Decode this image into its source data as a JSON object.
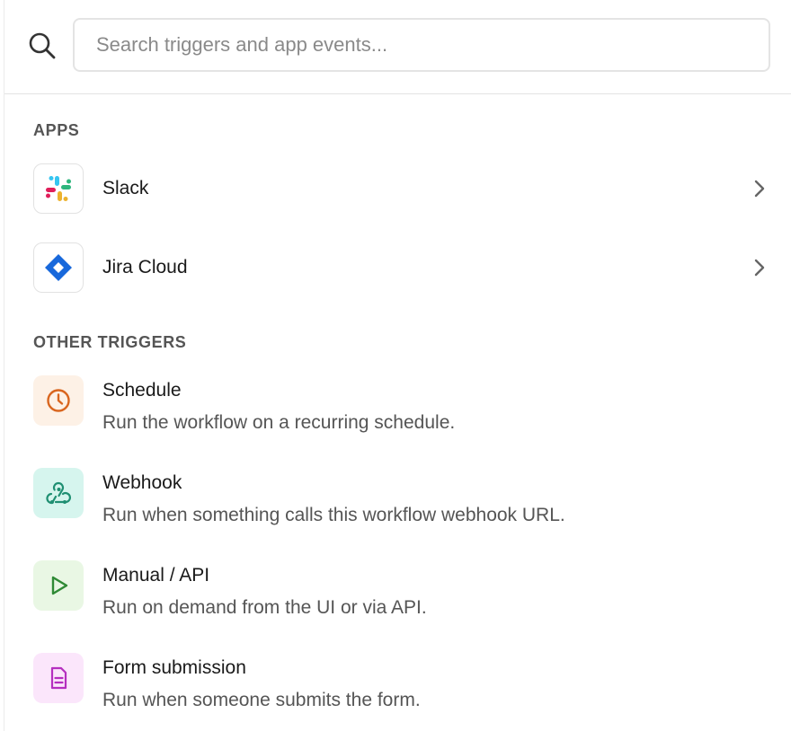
{
  "search": {
    "placeholder": "Search triggers and app events..."
  },
  "sections": {
    "apps_title": "APPS",
    "other_title": "OTHER TRIGGERS"
  },
  "apps": [
    {
      "label": "Slack",
      "icon": "slack-logo-icon"
    },
    {
      "label": "Jira Cloud",
      "icon": "jira-logo-icon"
    }
  ],
  "triggers": [
    {
      "title": "Schedule",
      "description": "Run the workflow on a recurring schedule.",
      "icon": "clock-icon",
      "icon_color": "#d9661f",
      "icon_bg": "#fdf1e6"
    },
    {
      "title": "Webhook",
      "description": "Run when something calls this workflow webhook URL.",
      "icon": "webhook-icon",
      "icon_color": "#1f8f72",
      "icon_bg": "#d6f5ee"
    },
    {
      "title": "Manual / API",
      "description": "Run on demand from the UI or via API.",
      "icon": "play-icon",
      "icon_color": "#2f8a35",
      "icon_bg": "#e9f7e4"
    },
    {
      "title": "Form submission",
      "description": "Run when someone submits the form.",
      "icon": "document-icon",
      "icon_color": "#b52fbf",
      "icon_bg": "#fbe6fb"
    }
  ]
}
